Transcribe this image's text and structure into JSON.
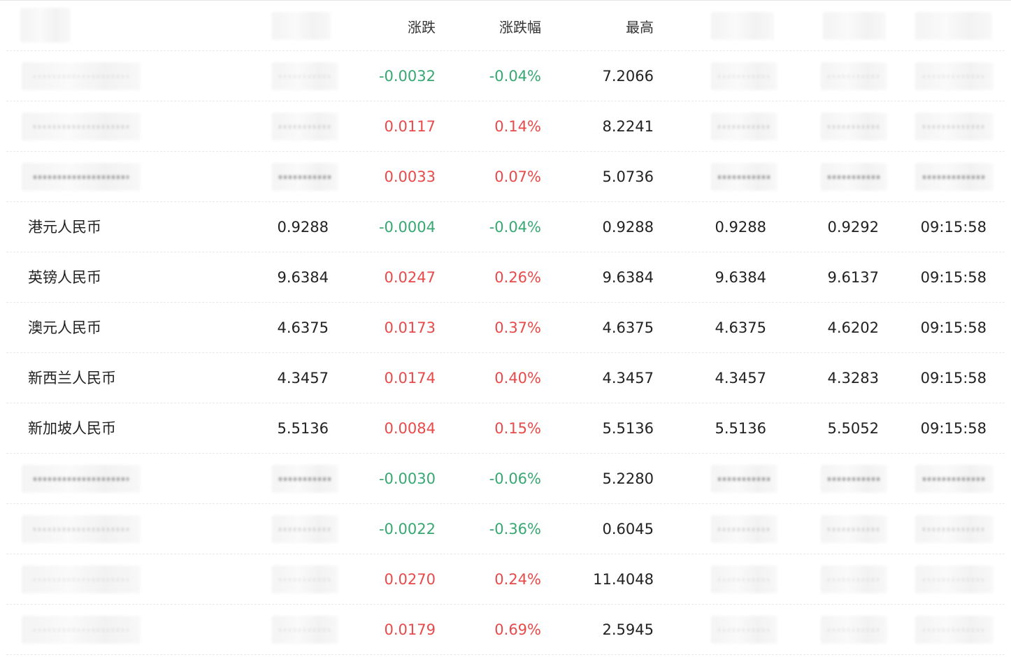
{
  "header": {
    "col_change": "涨跌",
    "col_change_pct": "涨跌幅",
    "col_high": "最高"
  },
  "rows": [
    {
      "name": "",
      "last": "",
      "change": "-0.0032",
      "change_pct": "-0.04%",
      "high": "7.2066",
      "low": "",
      "open": "",
      "time": "",
      "dir": "down"
    },
    {
      "name": "",
      "last": "",
      "change": "0.0117",
      "change_pct": "0.14%",
      "high": "8.2241",
      "low": "",
      "open": "",
      "time": "",
      "dir": "up"
    },
    {
      "name": "",
      "last": "",
      "change": "0.0033",
      "change_pct": "0.07%",
      "high": "5.0736",
      "low": "",
      "open": "",
      "time": "",
      "dir": "up"
    },
    {
      "name": "港元人民币",
      "last": "0.9288",
      "change": "-0.0004",
      "change_pct": "-0.04%",
      "high": "0.9288",
      "low": "0.9288",
      "open": "0.9292",
      "time": "09:15:58",
      "dir": "down"
    },
    {
      "name": "英镑人民币",
      "last": "9.6384",
      "change": "0.0247",
      "change_pct": "0.26%",
      "high": "9.6384",
      "low": "9.6384",
      "open": "9.6137",
      "time": "09:15:58",
      "dir": "up"
    },
    {
      "name": "澳元人民币",
      "last": "4.6375",
      "change": "0.0173",
      "change_pct": "0.37%",
      "high": "4.6375",
      "low": "4.6375",
      "open": "4.6202",
      "time": "09:15:58",
      "dir": "up"
    },
    {
      "name": "新西兰人民币",
      "last": "4.3457",
      "change": "0.0174",
      "change_pct": "0.40%",
      "high": "4.3457",
      "low": "4.3457",
      "open": "4.3283",
      "time": "09:15:58",
      "dir": "up"
    },
    {
      "name": "新加坡人民币",
      "last": "5.5136",
      "change": "0.0084",
      "change_pct": "0.15%",
      "high": "5.5136",
      "low": "5.5136",
      "open": "5.5052",
      "time": "09:15:58",
      "dir": "up"
    },
    {
      "name": "",
      "last": "",
      "change": "-0.0030",
      "change_pct": "-0.06%",
      "high": "5.2280",
      "low": "",
      "open": "",
      "time": "",
      "dir": "down"
    },
    {
      "name": "",
      "last": "",
      "change": "-0.0022",
      "change_pct": "-0.36%",
      "high": "0.6045",
      "low": "",
      "open": "",
      "time": "",
      "dir": "down"
    },
    {
      "name": "",
      "last": "",
      "change": "0.0270",
      "change_pct": "0.24%",
      "high": "11.4048",
      "low": "",
      "open": "",
      "time": "",
      "dir": "up"
    },
    {
      "name": "",
      "last": "",
      "change": "0.0179",
      "change_pct": "0.69%",
      "high": "2.5945",
      "low": "",
      "open": "",
      "time": "",
      "dir": "up"
    }
  ],
  "colors": {
    "up": "#e84a4a",
    "down": "#37a872",
    "text": "#222222",
    "divider": "#e9e9e9"
  }
}
